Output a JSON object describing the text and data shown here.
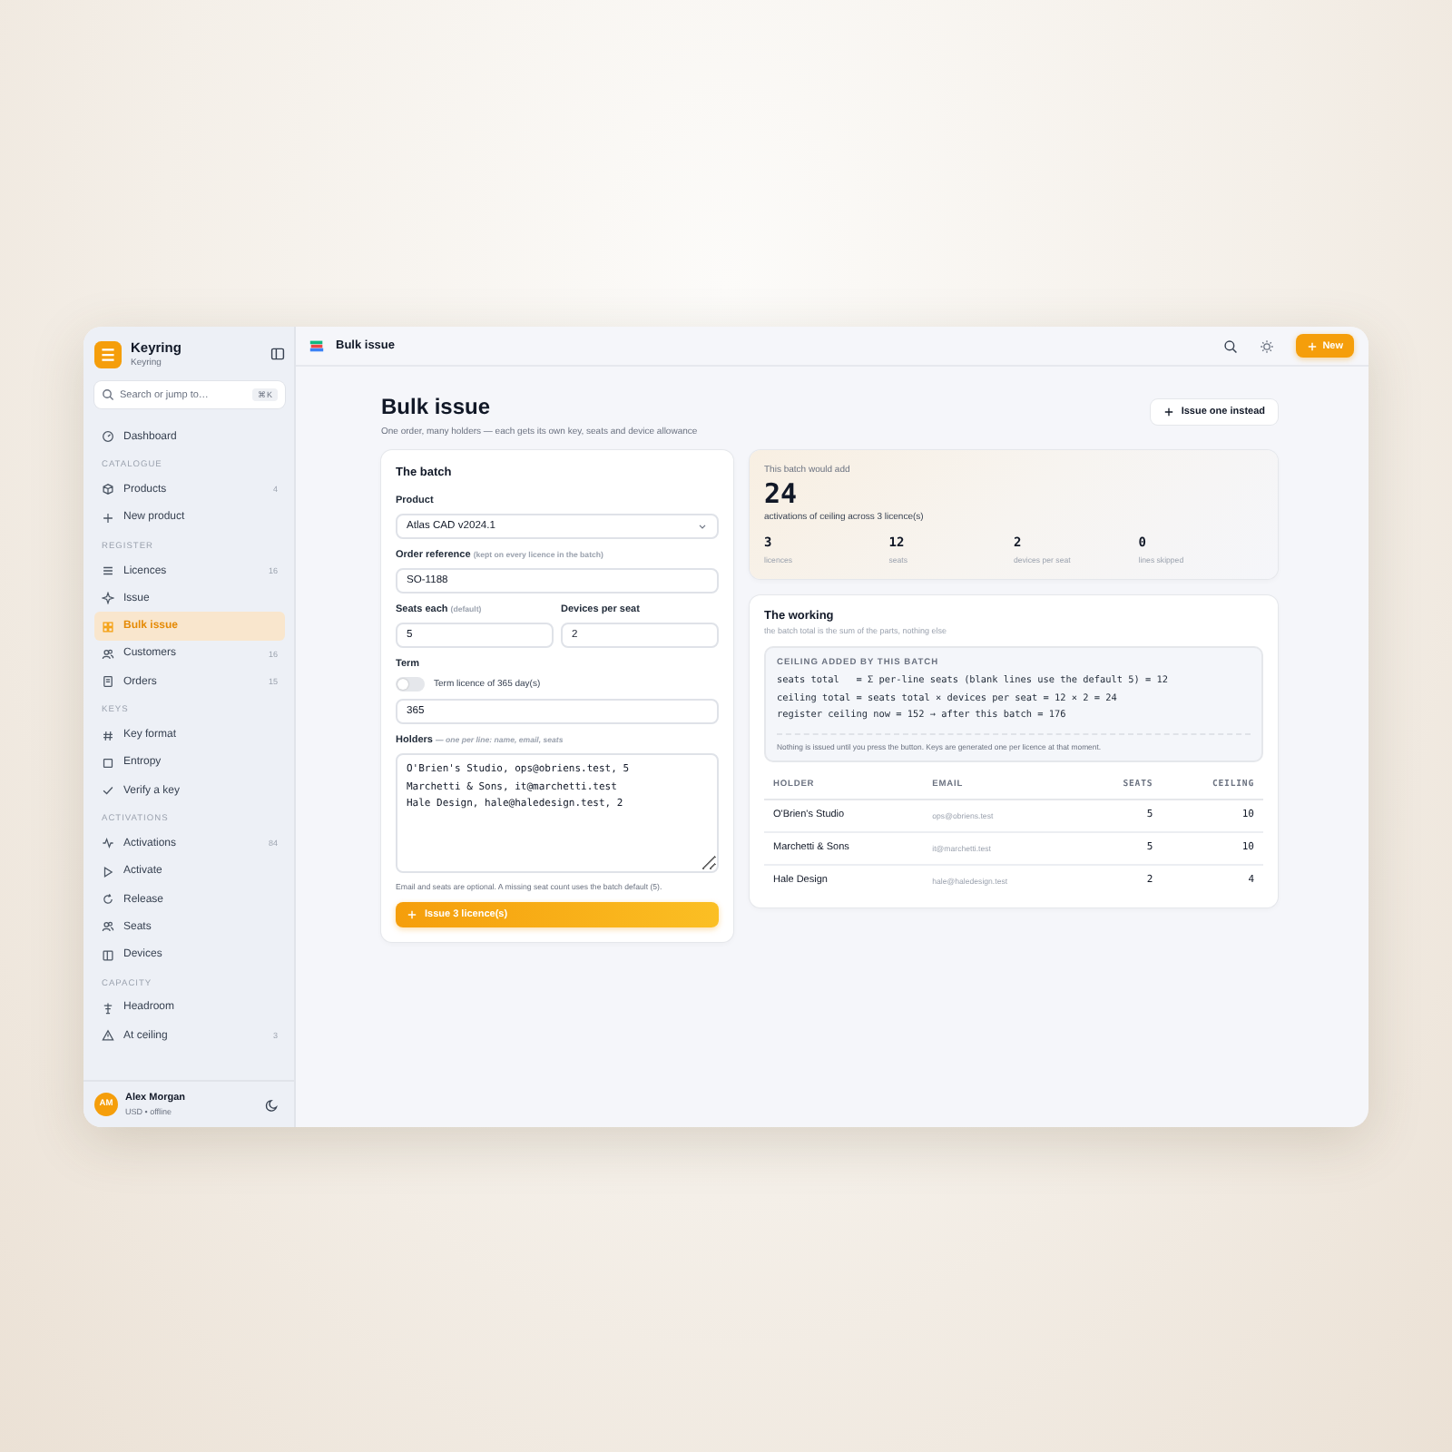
{
  "app": {
    "name": "Keyring",
    "subtitle": "Keyring"
  },
  "search": {
    "placeholder": "Search or jump to…",
    "shortcut": "⌘K"
  },
  "sidebar": {
    "top": [
      {
        "label": "Dashboard",
        "selected": false
      }
    ],
    "sections": [
      {
        "title": "CATALOGUE",
        "items": [
          {
            "label": "Products",
            "count": "4",
            "selected": false
          },
          {
            "label": "New product",
            "selected": false
          }
        ]
      },
      {
        "title": "REGISTER",
        "items": [
          {
            "label": "Licences",
            "count": "16",
            "selected": false
          },
          {
            "label": "Issue",
            "selected": false
          },
          {
            "label": "Bulk issue",
            "selected": true
          },
          {
            "label": "Customers",
            "count": "16",
            "selected": false
          },
          {
            "label": "Orders",
            "count": "15",
            "selected": false
          }
        ]
      },
      {
        "title": "KEYS",
        "items": [
          {
            "label": "Key format",
            "selected": false
          },
          {
            "label": "Entropy",
            "selected": false
          },
          {
            "label": "Verify a key",
            "selected": false
          }
        ]
      },
      {
        "title": "ACTIVATIONS",
        "items": [
          {
            "label": "Activations",
            "count": "84",
            "selected": false
          },
          {
            "label": "Activate",
            "selected": false
          },
          {
            "label": "Release",
            "selected": false
          },
          {
            "label": "Seats",
            "selected": false
          },
          {
            "label": "Devices",
            "selected": false
          }
        ]
      },
      {
        "title": "CAPACITY",
        "items": [
          {
            "label": "Headroom",
            "selected": false
          },
          {
            "label": "At ceiling",
            "count": "3",
            "selected": false
          }
        ]
      }
    ]
  },
  "user": {
    "initials": "AM",
    "name": "Alex Morgan",
    "status": "USD • offline"
  },
  "topbar": {
    "title": "Bulk issue",
    "new_button": "New"
  },
  "page": {
    "title": "Bulk issue",
    "subtitle": "One order, many holders — each gets its own key, seats and device allowance",
    "secondary_button": "Issue one instead"
  },
  "batch_form": {
    "title": "The batch",
    "product": {
      "label": "Product",
      "value": "Atlas CAD v2024.1"
    },
    "order_reference": {
      "label": "Order reference",
      "hint": "(kept on every licence in the batch)",
      "value": "SO-1188"
    },
    "seats_each": {
      "label": "Seats each",
      "hint": "(default)",
      "value": "5"
    },
    "devices_per_seat": {
      "label": "Devices per seat",
      "value": "2"
    },
    "term": {
      "label": "Term",
      "toggle_label": "Term licence of 365 day(s)",
      "on": false,
      "value": "365"
    },
    "holders": {
      "label": "Holders",
      "hint": "— one per line: name, email, seats",
      "lines": [
        "O'Brien's Studio, ops@obriens.test, 5",
        "Marchetti & Sons, it@marchetti.test",
        "Hale Design, hale@haledesign.test, 2"
      ]
    },
    "note": "Email and seats are optional. A missing seat count uses the batch default (5).",
    "submit": "Issue 3 licence(s)"
  },
  "summary": {
    "eyebrow": "This batch would add",
    "total": "24",
    "caption": "activations of ceiling across 3 licence(s)",
    "stats": [
      {
        "value": "3",
        "label": "licences"
      },
      {
        "value": "12",
        "label": "seats"
      },
      {
        "value": "2",
        "label": "devices per seat"
      },
      {
        "value": "0",
        "label": "lines skipped"
      }
    ]
  },
  "working": {
    "title": "The working",
    "subtitle": "the batch total is the sum of the parts, nothing else",
    "box_title": "CEILING ADDED BY THIS BATCH",
    "formula_lines": [
      "seats total   = Σ per-line seats (blank lines use the default 5) = 12",
      "ceiling total = seats total × devices per seat = 12 × 2 = 24",
      "register ceiling now = 152 → after this batch = 176"
    ],
    "note": "Nothing is issued until you press the button. Keys are generated one per licence at that moment.",
    "table": {
      "columns": [
        "HOLDER",
        "EMAIL",
        "SEATS",
        "CEILING"
      ],
      "rows": [
        [
          "O'Brien's Studio",
          "ops@obriens.test",
          "5",
          "10"
        ],
        [
          "Marchetti & Sons",
          "it@marchetti.test",
          "5",
          "10"
        ],
        [
          "Hale Design",
          "hale@haledesign.test",
          "2",
          "4"
        ]
      ]
    }
  }
}
